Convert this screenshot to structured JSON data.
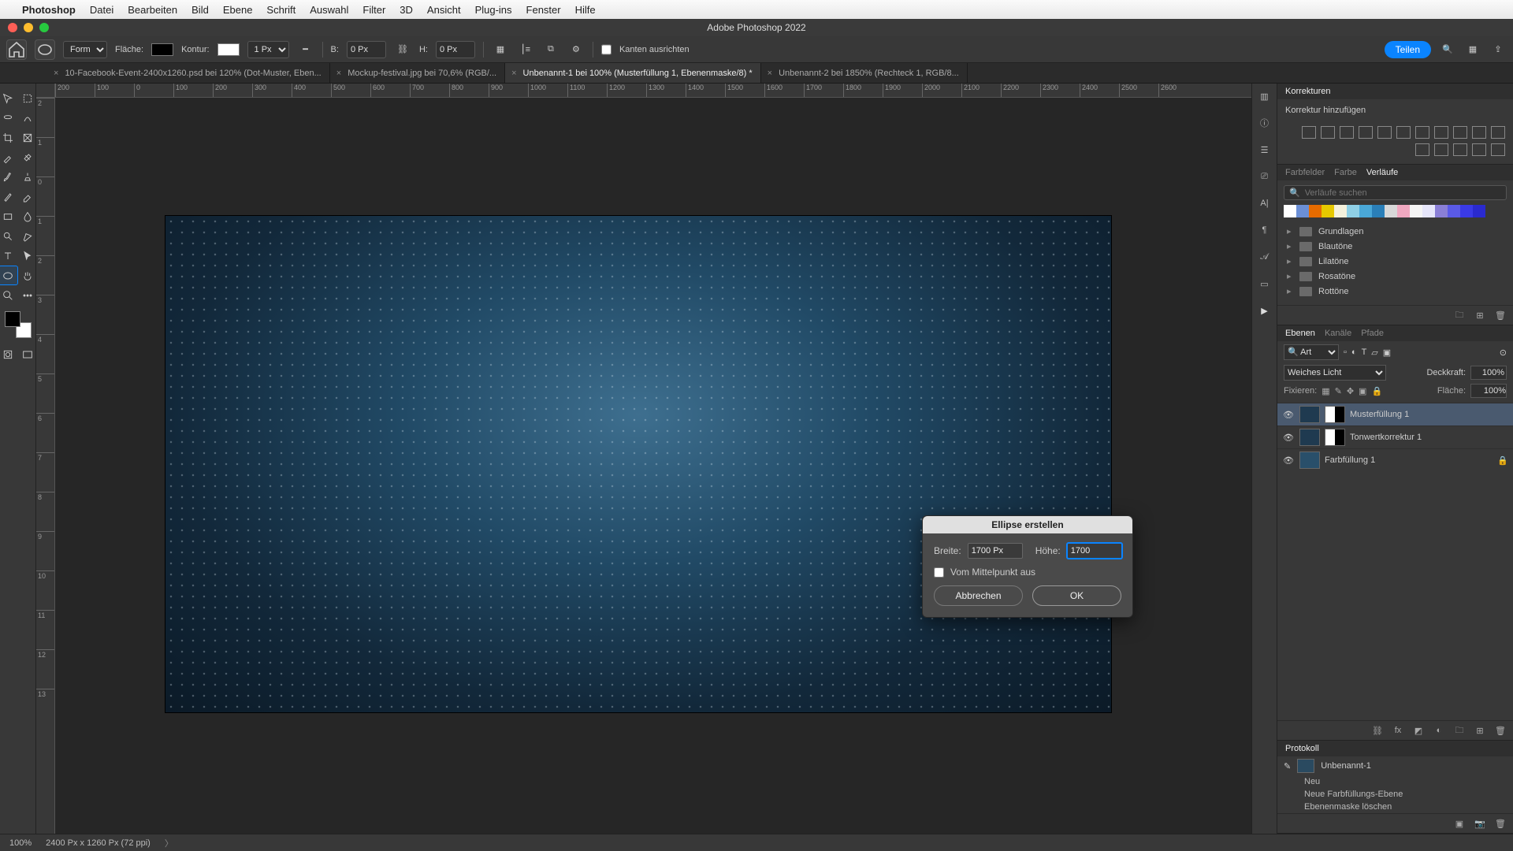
{
  "mac_menu": {
    "apple": "",
    "app": "Photoshop",
    "items": [
      "Datei",
      "Bearbeiten",
      "Bild",
      "Ebene",
      "Schrift",
      "Auswahl",
      "Filter",
      "3D",
      "Ansicht",
      "Plug-ins",
      "Fenster",
      "Hilfe"
    ]
  },
  "titlebar": {
    "title": "Adobe Photoshop 2022"
  },
  "optbar": {
    "mode_label": "Form",
    "fill_label": "Fläche:",
    "stroke_label": "Kontur:",
    "stroke_size": "1 Px",
    "w_label": "B:",
    "w_val": "0 Px",
    "h_label": "H:",
    "h_val": "0 Px",
    "align_label": "Kanten ausrichten",
    "share": "Teilen"
  },
  "tabs": [
    {
      "label": "10-Facebook-Event-2400x1260.psd bei 120% (Dot-Muster, Eben...",
      "active": false
    },
    {
      "label": "Mockup-festival.jpg bei 70,6% (RGB/...",
      "active": false
    },
    {
      "label": "Unbenannt-1 bei 100% (Musterfüllung 1, Ebenenmaske/8) *",
      "active": true
    },
    {
      "label": "Unbenannt-2 bei 1850% (Rechteck 1, RGB/8...",
      "active": false
    }
  ],
  "ruler_h": [
    "200",
    "100",
    "0",
    "100",
    "200",
    "300",
    "400",
    "500",
    "600",
    "700",
    "800",
    "900",
    "1000",
    "1100",
    "1200",
    "1300",
    "1400",
    "1500",
    "1600",
    "1700",
    "1800",
    "1900",
    "2000",
    "2100",
    "2200",
    "2300",
    "2400",
    "2500",
    "2600"
  ],
  "ruler_v": [
    "2",
    "1",
    "0",
    "1",
    "2",
    "3",
    "4",
    "5",
    "6",
    "7",
    "8",
    "9",
    "10",
    "11",
    "12",
    "13"
  ],
  "dialog": {
    "title": "Ellipse erstellen",
    "width_label": "Breite:",
    "width_val": "1700 Px",
    "height_label": "Höhe:",
    "height_val": "1700",
    "center_label": "Vom Mittelpunkt aus",
    "cancel": "Abbrechen",
    "ok": "OK"
  },
  "adjust_panel": {
    "title": "Korrekturen",
    "add": "Korrektur hinzufügen"
  },
  "gradients_panel": {
    "tabs": [
      "Farbfelder",
      "Farbe",
      "Verläufe"
    ],
    "search_ph": "Verläufe suchen",
    "swatches": [
      "#ffffff",
      "#6b8fd6",
      "#e66b00",
      "#e6c800",
      "#f5f1dc",
      "#8fd0e6",
      "#4aa8d8",
      "#2a7fb8",
      "#d8d8d8",
      "#f0a8c0",
      "#f5f5f5",
      "#e6e6fa",
      "#8a7fd6",
      "#5a5ae6",
      "#3a3ae6",
      "#2a2acf"
    ],
    "folders": [
      "Grundlagen",
      "Blautöne",
      "Lilatöne",
      "Rosatöne",
      "Rottöne"
    ]
  },
  "layers_panel": {
    "tabs": [
      "Ebenen",
      "Kanäle",
      "Pfade"
    ],
    "kind": "Art",
    "blend": "Weiches Licht",
    "opacity_label": "Deckkraft:",
    "opacity": "100%",
    "lock_label": "Fixieren:",
    "fill_label": "Fläche:",
    "fill": "100%",
    "layers": [
      {
        "name": "Musterfüllung 1",
        "sel": true,
        "mask": true
      },
      {
        "name": "Tonwertkorrektur 1",
        "sel": false,
        "mask": true
      },
      {
        "name": "Farbfüllung 1",
        "sel": false,
        "mask": false,
        "locked": true
      }
    ]
  },
  "history_panel": {
    "title": "Protokoll",
    "doc": "Unbenannt-1",
    "steps": [
      "Neu",
      "Neue Farbfüllungs-Ebene",
      "Ebenenmaske löschen"
    ]
  },
  "status": {
    "zoom": "100%",
    "dims": "2400 Px x 1260 Px (72 ppi)"
  }
}
